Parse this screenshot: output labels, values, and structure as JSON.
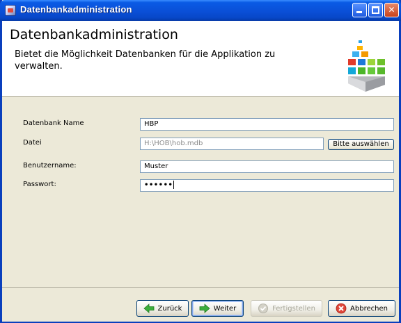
{
  "window": {
    "title": "Datenbankadministration"
  },
  "header": {
    "title": "Datenbankadministration",
    "description": "Bietet die Möglichkeit Datenbanken für die Applikation zu verwalten."
  },
  "form": {
    "db_name": {
      "label": "Datenbank Name",
      "value": "HBP"
    },
    "file": {
      "label": "Datei",
      "value": "H:\\HOB\\hob.mdb",
      "browse_label": "Bitte auswählen"
    },
    "username": {
      "label": "Benutzername:",
      "value": "Muster"
    },
    "password": {
      "label": "Passwort:",
      "value": "••••••"
    }
  },
  "footer": {
    "back_label": "Zurück",
    "next_label": "Weiter",
    "finish_label": "Fertigstellen",
    "cancel_label": "Abbrechen"
  },
  "colors": {
    "titlebar": "#0a4fd7",
    "header_bg": "#ffffff",
    "dialog_bg": "#ece9d8",
    "input_border": "#7f9db9"
  }
}
